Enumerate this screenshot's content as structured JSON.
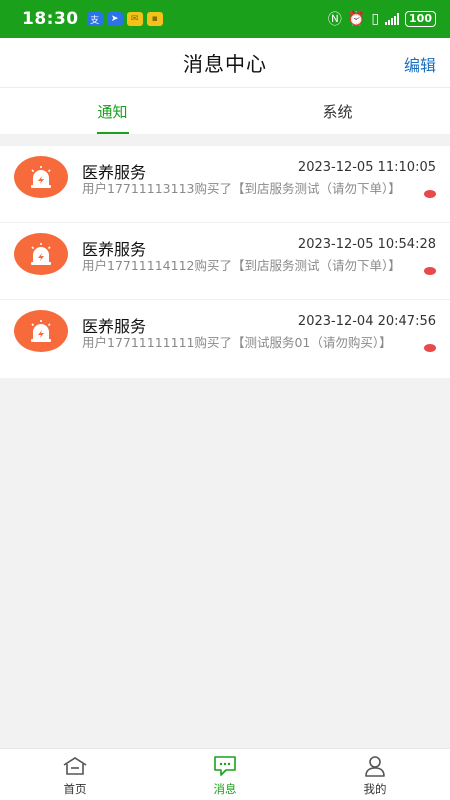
{
  "status_bar": {
    "time": "18:30",
    "battery": "100",
    "left_icons": [
      "alipay-icon",
      "location-icon",
      "mail-icon",
      "app-badge-icon"
    ],
    "right_icons": [
      "nfc-icon",
      "alarm-icon",
      "vibrate-icon",
      "signal-icon"
    ]
  },
  "header": {
    "title": "消息中心",
    "edit_label": "编辑"
  },
  "tabs": [
    {
      "label": "通知",
      "active": true
    },
    {
      "label": "系统",
      "active": false
    }
  ],
  "messages": [
    {
      "title": "医养服务",
      "time": "2023-12-05 11:10:05",
      "desc": "用户17711113113购买了【到店服务测试（请勿下单）】",
      "unread": true
    },
    {
      "title": "医养服务",
      "time": "2023-12-05 10:54:28",
      "desc": "用户17711114112购买了【到店服务测试（请勿下单）】",
      "unread": true
    },
    {
      "title": "医养服务",
      "time": "2023-12-04 20:47:56",
      "desc": "用户17711111111购买了【测试服务01（请勿购买）】",
      "unread": true
    }
  ],
  "bottom_nav": [
    {
      "label": "首页",
      "icon": "home-icon",
      "active": false
    },
    {
      "label": "消息",
      "icon": "message-icon",
      "active": true
    },
    {
      "label": "我的",
      "icon": "user-icon",
      "active": false
    }
  ],
  "colors": {
    "brand_green": "#1aa01a",
    "edit_blue": "#1a6fbf",
    "alarm_orange": "#f66a3c",
    "unread_red": "#e84a4a"
  }
}
